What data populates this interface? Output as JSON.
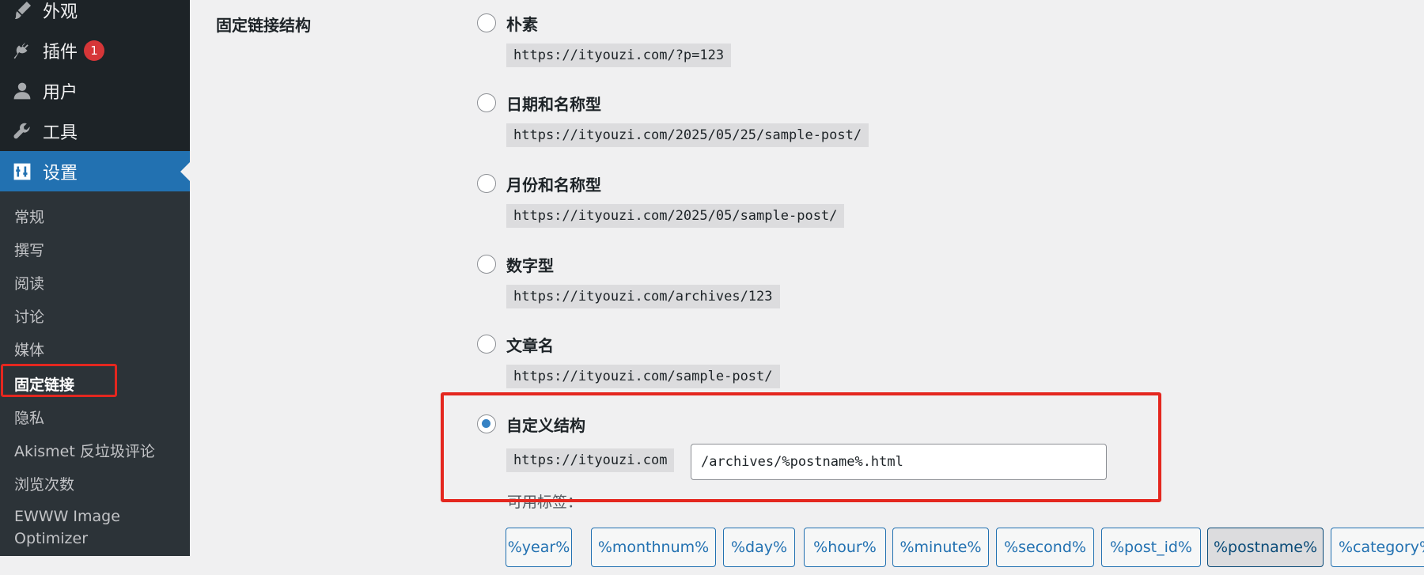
{
  "sidebar": {
    "menu": [
      {
        "label": "外观",
        "icon": "appearance-brush-icon"
      },
      {
        "label": "插件",
        "icon": "plugins-plug-icon",
        "badge": "1"
      },
      {
        "label": "用户",
        "icon": "users-person-icon"
      },
      {
        "label": "工具",
        "icon": "tools-wrench-icon"
      },
      {
        "label": "设置",
        "icon": "settings-sliders-icon",
        "current": true
      }
    ],
    "submenu": [
      "常规",
      "撰写",
      "阅读",
      "讨论",
      "媒体",
      "固定链接",
      "隐私",
      "Akismet 反垃圾评论",
      "浏览次数",
      "EWWW Image",
      "Optimizer"
    ],
    "active_submenu": "固定链接"
  },
  "main": {
    "section_label": "固定链接结构",
    "options": [
      {
        "label": "朴素",
        "example": "https://ityouzi.com/?p=123",
        "checked": false
      },
      {
        "label": "日期和名称型",
        "example": "https://ityouzi.com/2025/05/25/sample-post/",
        "checked": false
      },
      {
        "label": "月份和名称型",
        "example": "https://ityouzi.com/2025/05/sample-post/",
        "checked": false
      },
      {
        "label": "数字型",
        "example": "https://ityouzi.com/archives/123",
        "checked": false
      },
      {
        "label": "文章名",
        "example": "https://ityouzi.com/sample-post/",
        "checked": false
      },
      {
        "label": "自定义结构",
        "example": "https://ityouzi.com",
        "checked": true
      }
    ],
    "custom_structure_value": "/archives/%postname%.html",
    "available_tags_label": "可用标签：",
    "tags": [
      "%year%",
      "%monthnum%",
      "%day%",
      "%hour%",
      "%minute%",
      "%second%",
      "%post_id%",
      "%postname%",
      "%category%"
    ],
    "pressed_tag": "%postname%",
    "highlight_color": "#e4271f",
    "accent_color": "#2271b1"
  }
}
